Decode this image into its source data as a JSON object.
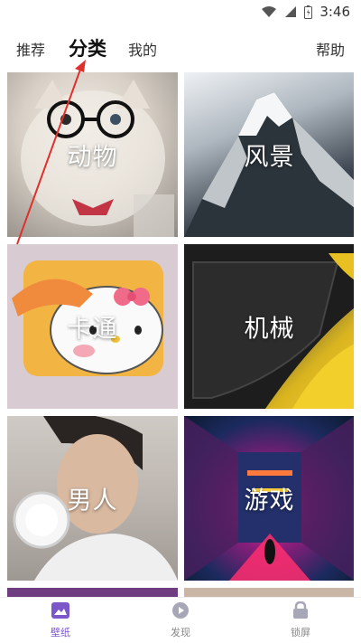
{
  "status": {
    "time": "3:46"
  },
  "header": {
    "tabs": [
      {
        "label": "推荐"
      },
      {
        "label": "分类"
      },
      {
        "label": "我的"
      }
    ],
    "help_label": "帮助"
  },
  "categories": [
    {
      "label": "动物"
    },
    {
      "label": "风景"
    },
    {
      "label": "卡通"
    },
    {
      "label": "机械"
    },
    {
      "label": "男人"
    },
    {
      "label": "游戏"
    }
  ],
  "bottom_nav": {
    "items": [
      {
        "label": "壁纸",
        "icon": "wallpaper-icon"
      },
      {
        "label": "发现",
        "icon": "discover-icon"
      },
      {
        "label": "锁屏",
        "icon": "lock-icon"
      }
    ]
  },
  "colors": {
    "accent": "#7c57c9",
    "annotation_arrow": "#e0302b"
  }
}
